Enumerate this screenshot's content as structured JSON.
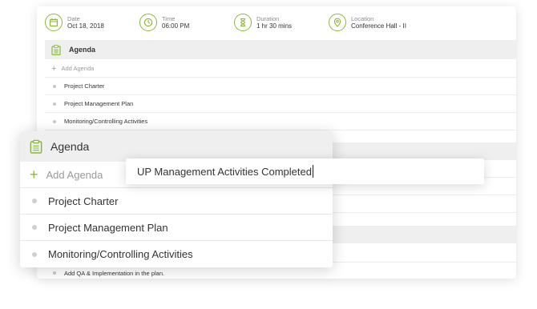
{
  "meeting": {
    "date": {
      "label": "Date",
      "value": "Oct 18, 2018",
      "icon": "calendar-icon"
    },
    "time": {
      "label": "Time",
      "value": "06:00 PM",
      "icon": "clock-icon"
    },
    "duration": {
      "label": "Duration",
      "value": "1 hr 30 mins",
      "icon": "hourglass-icon"
    },
    "location": {
      "label": "Location",
      "value": "Conference Hall - II",
      "icon": "map-pin-icon"
    }
  },
  "agenda": {
    "title": "Agenda",
    "add_label": "Add Agenda",
    "items": [
      "Project Charter",
      "Project Management Plan",
      "Monitoring/Controlling Activities"
    ],
    "extra_item": "Add QA & Implementation in the plan."
  },
  "editor": {
    "value": "UP Management Activities Completed"
  },
  "colors": {
    "accent": "#8bb83a",
    "header_bg": "#efefef"
  }
}
